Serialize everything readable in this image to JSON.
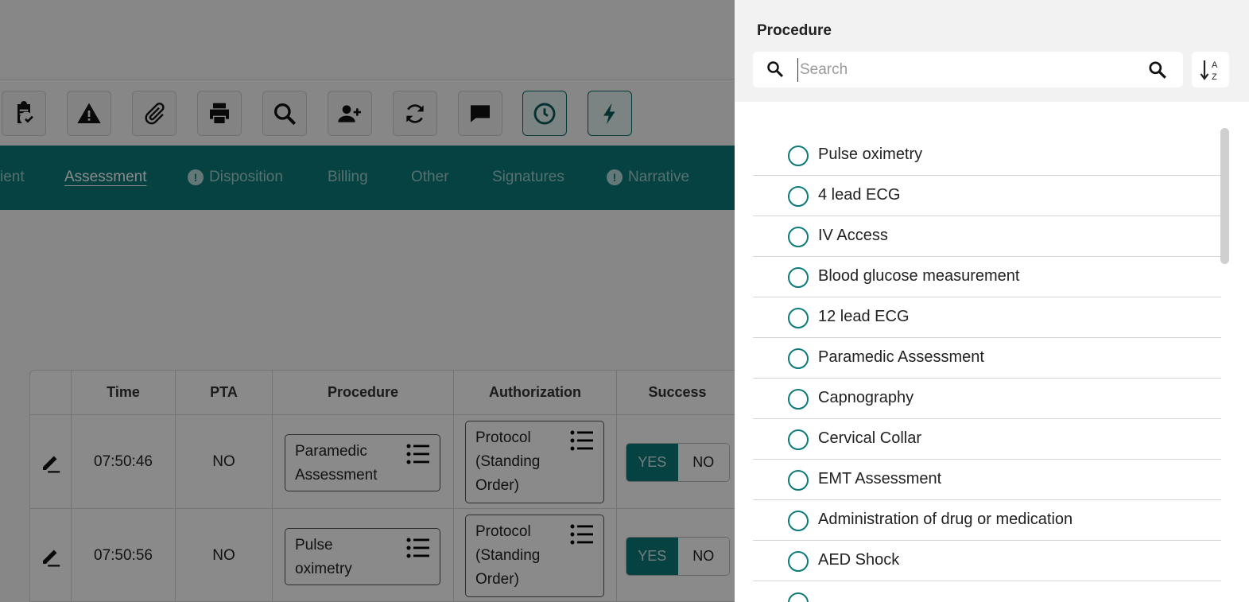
{
  "nav_tabs": [
    {
      "label": "ient",
      "warning": false
    },
    {
      "label": "Assessment",
      "warning": false,
      "active": true
    },
    {
      "label": "Disposition",
      "warning": true
    },
    {
      "label": "Billing",
      "warning": false
    },
    {
      "label": "Other",
      "warning": false
    },
    {
      "label": "Signatures",
      "warning": false
    },
    {
      "label": "Narrative",
      "warning": true
    }
  ],
  "warning_glyph": "!",
  "toolbar_icons": [
    "clipboard-check-icon",
    "warning-icon",
    "paperclip-icon",
    "printer-icon",
    "search-icon",
    "add-person-icon",
    "refresh-icon",
    "chat-icon",
    "clock-icon",
    "lightning-icon"
  ],
  "table": {
    "headers": [
      "Time",
      "PTA",
      "Procedure",
      "Authorization",
      "Success"
    ],
    "rows": [
      {
        "time": "07:50:46",
        "pta": "NO",
        "procedure": "Paramedic Assessment",
        "authorization": "Protocol (Standing Order)",
        "yes": "YES",
        "no": "NO"
      },
      {
        "time": "07:50:56",
        "pta": "NO",
        "procedure": "Pulse oximetry",
        "authorization": "Protocol (Standing Order)",
        "yes": "YES",
        "no": "NO"
      }
    ]
  },
  "panel": {
    "title": "Procedure",
    "search_placeholder": "Search",
    "sort_icon": "sort-alpha-icon",
    "items": [
      "Pulse oximetry",
      "4 lead ECG",
      "IV Access",
      "Blood glucose measurement",
      "12 lead ECG",
      "Paramedic Assessment",
      "Capnography",
      "Cervical Collar",
      "EMT Assessment",
      "Administration of drug or medication",
      "AED Shock"
    ]
  },
  "colors": {
    "teal": "#0d7a7a",
    "radio": "#0d7a7a",
    "overlay": "rgba(0,0,0,0.46)"
  }
}
